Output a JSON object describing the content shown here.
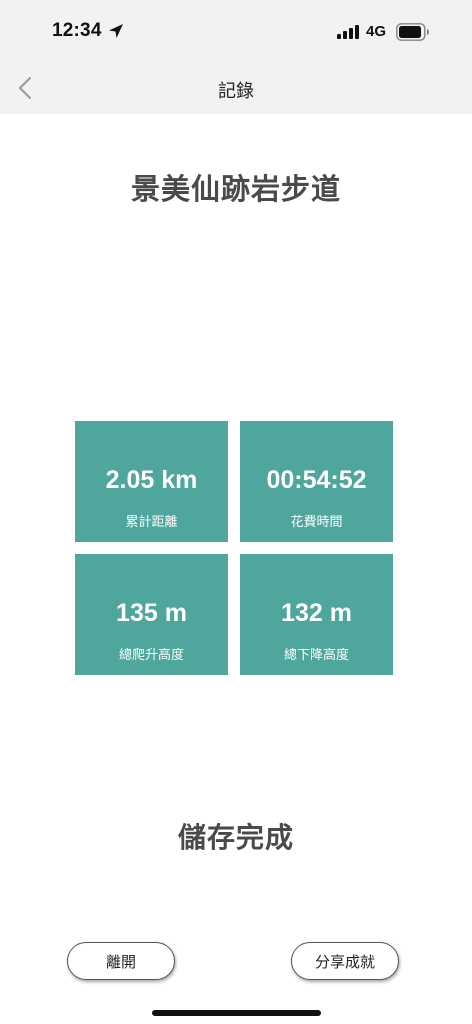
{
  "status_bar": {
    "time": "12:34",
    "network": "4G",
    "icons": [
      "location-arrow-icon",
      "cellular-signal-icon",
      "battery-icon"
    ]
  },
  "nav": {
    "title": "記錄",
    "back_icon": "chevron-left-icon"
  },
  "trail": {
    "name": "景美仙跡岩步道"
  },
  "stats": [
    {
      "value": "2.05 km",
      "label": "累計距離"
    },
    {
      "value": "00:54:52",
      "label": "花費時間"
    },
    {
      "value": "135 m",
      "label": "總爬升高度"
    },
    {
      "value": "132 m",
      "label": "總下降高度"
    }
  ],
  "message": "儲存完成",
  "buttons": {
    "leave": "離開",
    "share": "分享成就"
  },
  "colors": {
    "card": "#4ea69c",
    "bar_background": "#f2f2f2",
    "title_text": "#4a4a4a"
  }
}
